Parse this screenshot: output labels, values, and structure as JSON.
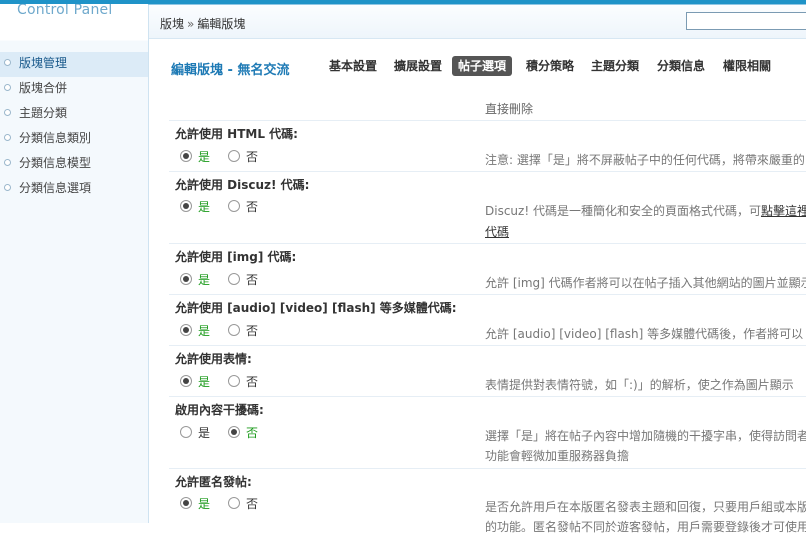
{
  "sidebar": {
    "brand": "Control Panel",
    "items": [
      {
        "label": "版塊管理"
      },
      {
        "label": "版塊合併"
      },
      {
        "label": "主題分類"
      },
      {
        "label": "分類信息類別"
      },
      {
        "label": "分類信息模型"
      },
      {
        "label": "分類信息選項"
      }
    ]
  },
  "header": {
    "crumb_root": "版塊",
    "crumb_sep": "»",
    "crumb_current": "編輯版塊",
    "search_value": ""
  },
  "main": {
    "title": "編輯版塊 - 無名交流",
    "tabs": [
      {
        "label": "基本設置"
      },
      {
        "label": "擴展設置"
      },
      {
        "label": "帖子選項"
      },
      {
        "label": "積分策略"
      },
      {
        "label": "主題分類"
      },
      {
        "label": "分類信息"
      },
      {
        "label": "權限相關"
      }
    ],
    "top_note": "直接刪除",
    "yes_label": "是",
    "no_label": "否",
    "settings": [
      {
        "label": "允許使用 HTML 代碼:",
        "value": "yes",
        "desc": "注意: 選擇「是」將不屏蔽帖子中的任何代碼，將帶來嚴重的"
      },
      {
        "label": "允許使用 Discuz! 代碼:",
        "value": "yes",
        "desc": "Discuz! 代碼是一種簡化和安全的頁面格式代碼，可",
        "desc_link": "點擊這裡",
        "desc2": "代碼"
      },
      {
        "label": "允許使用 [img] 代碼:",
        "value": "yes",
        "desc": "允許 [img] 代碼作者將可以在帖子插入其他網站的圖片並顯示"
      },
      {
        "label": "允許使用 [audio] [video] [flash] 等多媒體代碼:",
        "value": "yes",
        "desc": "允許 [audio] [video] [flash] 等多媒體代碼後，作者將可以"
      },
      {
        "label": "允許使用表情:",
        "value": "yes",
        "desc": "表情提供對表情符號，如「:)」的解析，使之作為圖片顯示"
      },
      {
        "label": "啟用內容干擾碼:",
        "value": "no",
        "desc": "選擇「是」將在帖子內容中增加隨機的干擾字串，使得訪問者",
        "desc2": "功能會輕微加重服務器負擔"
      },
      {
        "label": "允許匿名發帖:",
        "value": "yes",
        "desc": "是否允許用戶在本版匿名發表主題和回復，只要用戶組或本版",
        "desc2": "的功能。匿名發帖不同於遊客發帖，用戶需要登錄後才可使用"
      }
    ]
  }
}
